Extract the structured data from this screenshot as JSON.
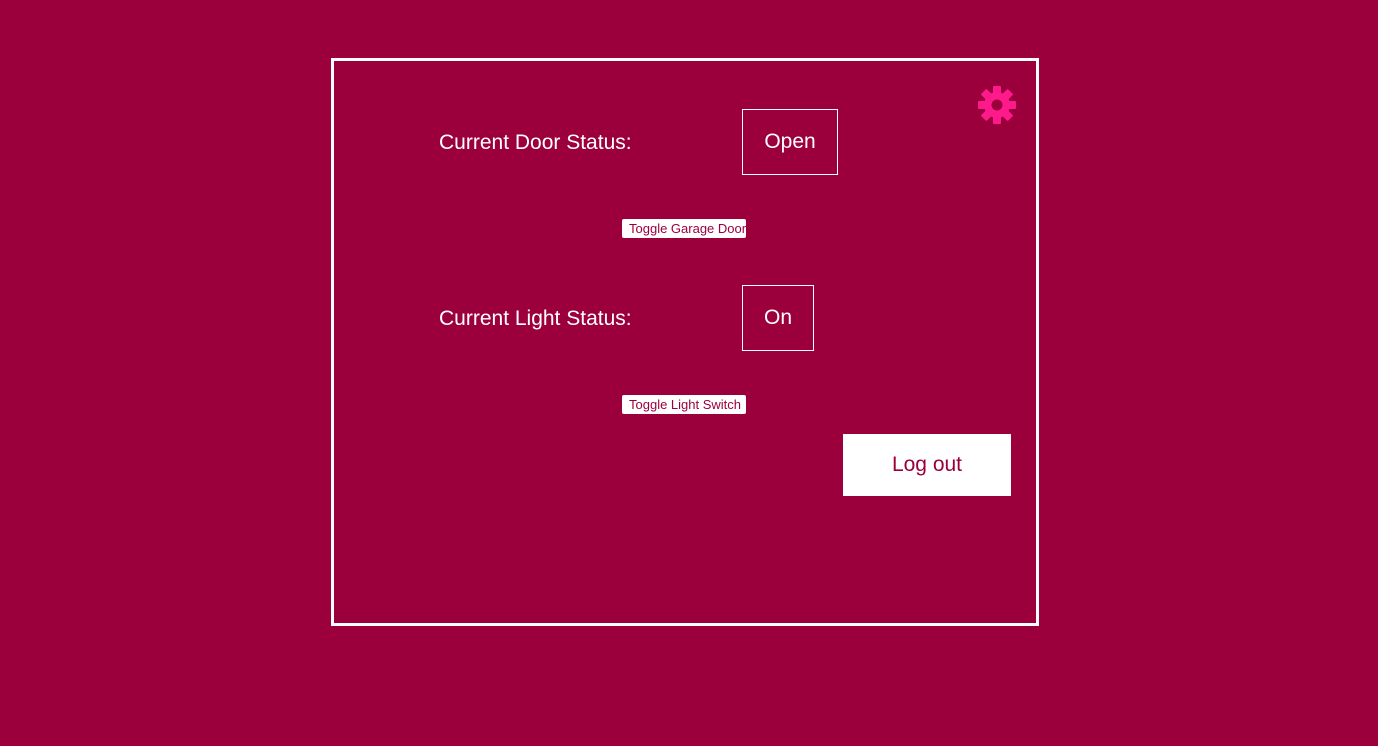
{
  "colors": {
    "background": "#9c003c",
    "foreground": "#ffffff",
    "accent": "#ff1a8c"
  },
  "settings": {
    "icon": "gear-icon"
  },
  "door": {
    "label": "Current Door Status:",
    "status": "Open",
    "toggle_label": "Toggle Garage Door"
  },
  "light": {
    "label": "Current Light Status:",
    "status": "On",
    "toggle_label": "Toggle Light Switch"
  },
  "logout": {
    "label": "Log out"
  }
}
